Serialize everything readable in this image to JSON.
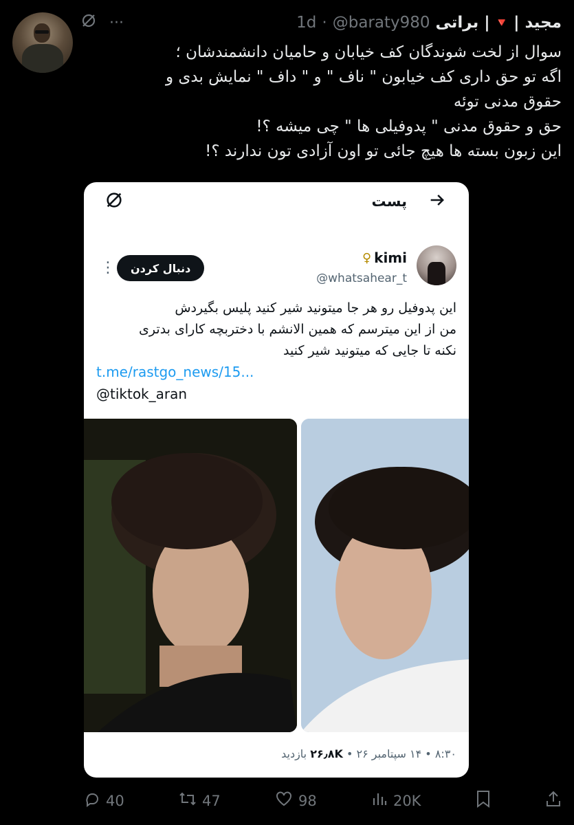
{
  "tweet": {
    "display_name": "| مجید",
    "badge": "🔻",
    "display_name_2": "براتی |",
    "handle": "@baraty980",
    "separator": "·",
    "time": "1d",
    "text_lines": [
      "سوال از لخت شوندگان کف خیابان و حامیان دانشمندشان ؛",
      "اگه تو حق داری کف خیابون \" ناف \" و \" داف \" نمایش بدی و",
      "حقوق مدنی توئه",
      "حق و حقوق مدنی \" پدوفیلی ها \" چی میشه ؟!",
      "این زبون بسته ها هیچ جائی تو اون آزادی تون ندارند ؟!"
    ],
    "icons": {
      "grok": "grok-icon",
      "more": "more-icon"
    }
  },
  "quoted_screenshot": {
    "header_title": "پست",
    "back_icon": "arrow-right-icon",
    "grok_icon": "grok-icon",
    "author_name": "kimi",
    "author_symbol": "♀",
    "author_handle": "@whatsahear_t",
    "follow_label": "دنبال کردن",
    "text_lines": [
      "این پدوفیل رو هر جا میتونید شیر کنید پلیس بگیردش",
      "من از این میترسم که همین الانشم با دختربچه کارای بدتری",
      "نکنه تا جایی که میتونید شیر کنید"
    ],
    "link": "t.me/rastgo_news/15...",
    "mention": "@tiktok_aran",
    "meta_time": "۸:۳۰ • ۱۴ سپتامبر ۲۶ • ",
    "meta_views": "۲۶٫۸K",
    "meta_views_label": " بازدید"
  },
  "actions": {
    "reply_count": "40",
    "retweet_count": "47",
    "like_count": "98",
    "view_count": "20K"
  },
  "colors": {
    "background": "#000000",
    "text": "#e7e9ea",
    "muted": "#71767b",
    "link": "#1d9bf0",
    "badge": "#e0245e"
  }
}
